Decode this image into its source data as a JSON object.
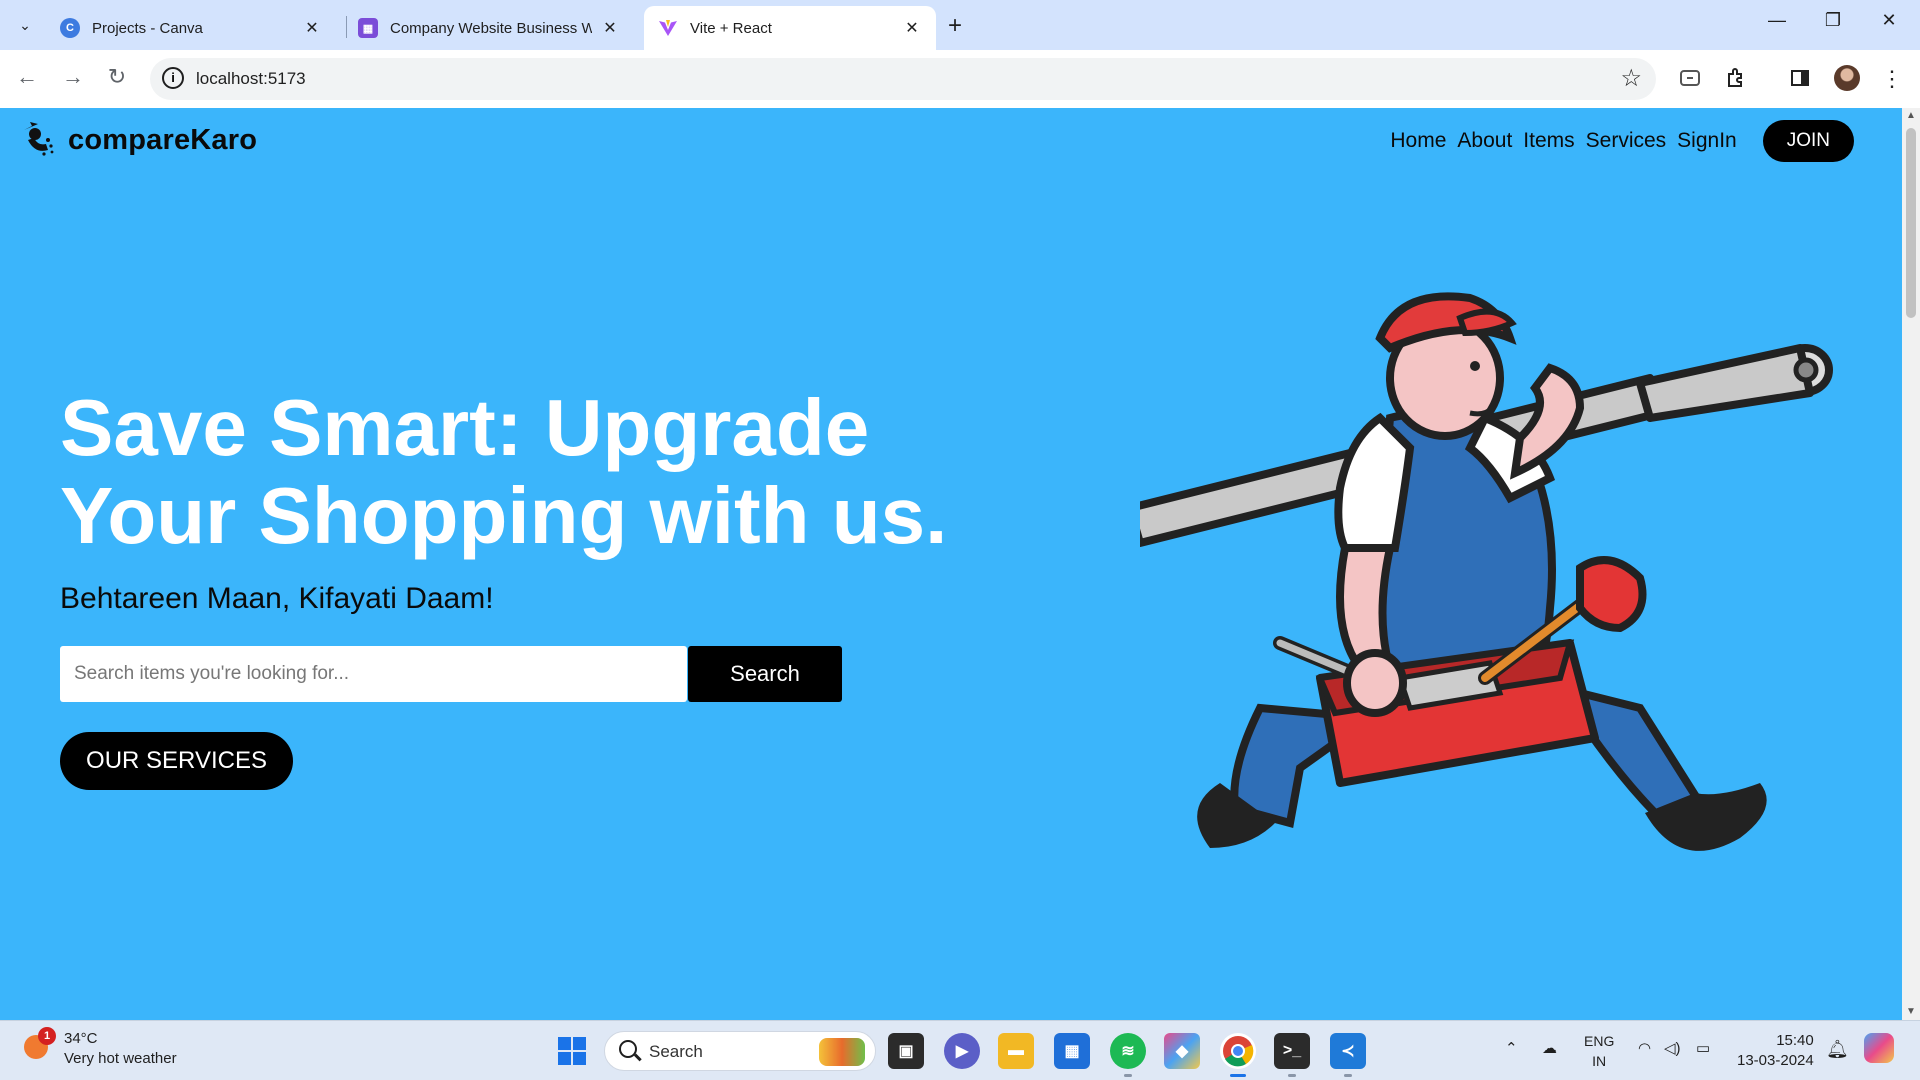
{
  "browser": {
    "tabs": [
      {
        "title": "Projects - Canva",
        "favicon": "canva-icon",
        "color": "#3d7be0",
        "active": false
      },
      {
        "title": "Company Website Business We",
        "favicon": "calendar-icon",
        "color": "#7b4dd8",
        "active": false
      },
      {
        "title": "Vite + React",
        "favicon": "vite-icon",
        "color": "#a855f7",
        "active": true
      }
    ],
    "url": "localhost:5173"
  },
  "site": {
    "brand": "compareKaro",
    "nav": [
      "Home",
      "About",
      "Items",
      "Services",
      "SignIn"
    ],
    "join_label": "JOIN",
    "hero": {
      "title_line1": "Save Smart: Upgrade",
      "title_line2": "Your Shopping with us.",
      "subtitle": "Behtareen Maan, Kifayati Daam!",
      "search_placeholder": "Search items you're looking for...",
      "search_button": "Search",
      "services_button": "OUR SERVICES"
    },
    "colors": {
      "background": "#3bb5fb",
      "button": "#000000"
    }
  },
  "taskbar": {
    "weather": {
      "temp": "34°C",
      "desc": "Very hot weather",
      "badge": "1"
    },
    "search_label": "Search",
    "lang_line1": "ENG",
    "lang_line2": "IN",
    "time": "15:40",
    "date": "13-03-2024"
  }
}
